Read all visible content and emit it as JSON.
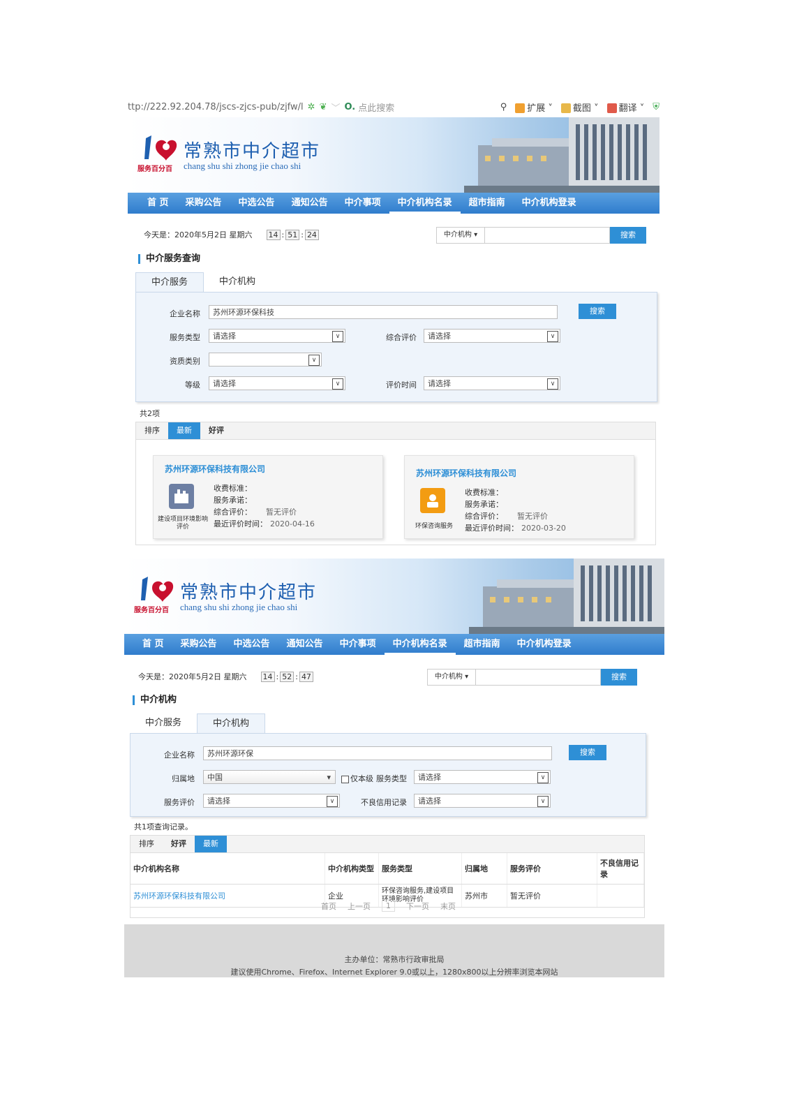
{
  "browser": {
    "url": "ttp://222.92.204.78/jscs-zjcs-pub/zjfw/l",
    "search_placeholder": "点此搜索",
    "tools": [
      "扩展",
      "截图",
      "翻译"
    ]
  },
  "site": {
    "title_cn": "常熟市中介超市",
    "title_pinyin": "chang shu shi zhong jie chao shi",
    "logo_caption": "服务百分百",
    "nav": [
      "首 页",
      "采购公告",
      "中选公告",
      "通知公告",
      "中介事项",
      "中介机构名录",
      "超市指南",
      "中介机构登录"
    ],
    "active_nav": "中介机构名录",
    "today_label": "今天是：",
    "date": "2020年5月2日 星期六",
    "top_search_select": "中介机构",
    "top_search_btn": "搜索"
  },
  "screen1": {
    "time": [
      "14",
      "51",
      "24"
    ],
    "section_title": "中介服务查询",
    "tabs": [
      "中介服务",
      "中介机构"
    ],
    "form": {
      "company_label": "企业名称",
      "company_value": "苏州环源环保科技",
      "search_btn": "搜索",
      "service_type_label": "服务类型",
      "service_type_value": "请选择",
      "rating_label": "综合评价",
      "rating_value": "请选择",
      "qual_label": "资质类别",
      "qual_value": "",
      "level_label": "等级",
      "level_value": "请选择",
      "eval_time_label": "评价时间",
      "eval_time_value": "请选择"
    },
    "count": "共2项",
    "sort": [
      "排序",
      "最新",
      "好评"
    ],
    "cards": [
      {
        "title": "苏州环源环保科技有限公司",
        "icon_caption": "建设项目环境影响评价",
        "fee_label": "收费标准：",
        "promise_label": "服务承诺：",
        "rating_label": "综合评价：",
        "rating_value": "暂无评价",
        "last_label": "最近评价时间：",
        "last_value": "2020-04-16",
        "icon_color": "#6d7fa3"
      },
      {
        "title": "苏州环源环保科技有限公司",
        "icon_caption": "环保咨询服务",
        "fee_label": "收费标准：",
        "promise_label": "服务承诺：",
        "rating_label": "综合评价：",
        "rating_value": "暂无评价",
        "last_label": "最近评价时间：",
        "last_value": "2020-03-20",
        "icon_color": "#f39c12"
      }
    ]
  },
  "screen2": {
    "time": [
      "14",
      "52",
      "47"
    ],
    "section_title": "中介机构",
    "tabs": [
      "中介服务",
      "中介机构"
    ],
    "form": {
      "company_label": "企业名称",
      "company_value": "苏州环源环保",
      "search_btn": "搜索",
      "region_label": "归属地",
      "region_value": "中国",
      "local_only": "仅本级",
      "service_type_label": "服务类型",
      "service_type_value": "请选择",
      "service_eval_label": "服务评价",
      "service_eval_value": "请选择",
      "bad_credit_label": "不良信用记录",
      "bad_credit_value": "请选择"
    },
    "count": "共1项查询记录。",
    "sort": [
      "排序",
      "好评",
      "最新"
    ],
    "table": {
      "headers": [
        "中介机构名称",
        "中介机构类型",
        "服务类型",
        "归属地",
        "服务评价",
        "不良信用记录"
      ],
      "rows": [
        [
          "苏州环源环保科技有限公司",
          "企业",
          "环保咨询服务,建设项目环境影响评价",
          "苏州市",
          "暂无评价",
          ""
        ]
      ]
    },
    "pager": [
      "首页",
      "上一页",
      "1",
      "下一页",
      "末页"
    ]
  },
  "footer": {
    "line1": "主办单位：常熟市行政审批局",
    "line2": "建议使用Chrome、Firefox、Internet Explorer 9.0或以上，1280x800以上分辨率浏览本网站"
  },
  "colors": {
    "accent": "#2e8fd6",
    "nav": "#3b86d2",
    "logo_red": "#c8102e"
  }
}
